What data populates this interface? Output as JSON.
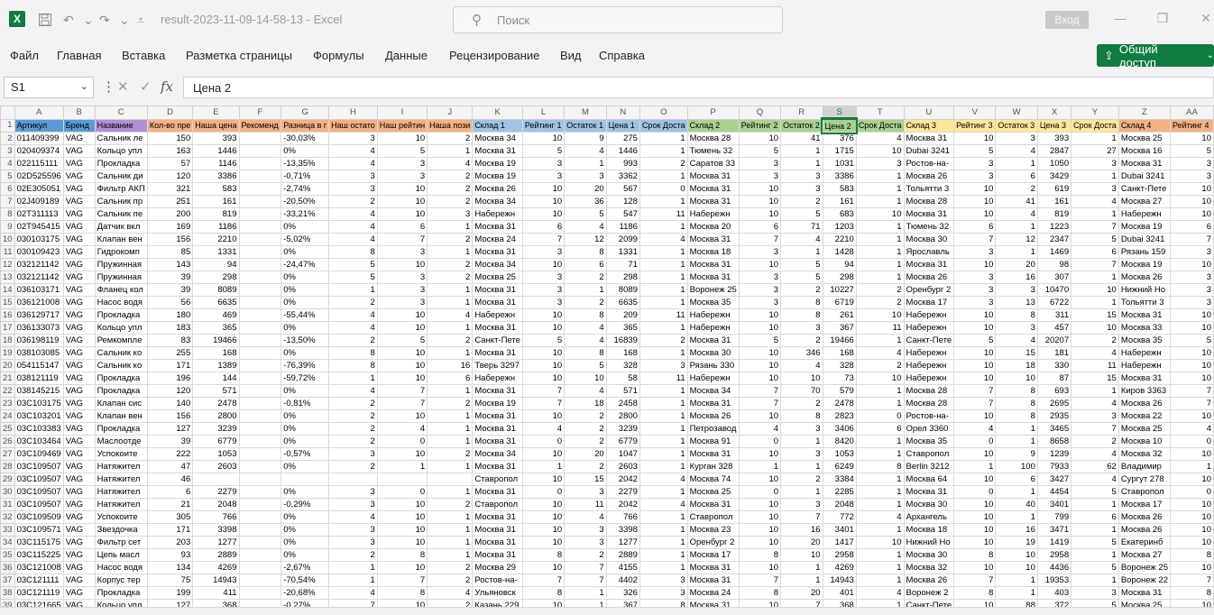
{
  "window": {
    "title": "result-2023-11-09-14-58-13",
    "sep": "-",
    "app": "Excel",
    "search_placeholder": "Поиск",
    "signin_label": "Вход"
  },
  "ribbon_tabs": [
    "Файл",
    "Главная",
    "Вставка",
    "Разметка страницы",
    "Формулы",
    "Данные",
    "Рецензирование",
    "Вид",
    "Справка"
  ],
  "share_label": "Общий доступ",
  "formula_bar": {
    "name_box": "S1",
    "formula": "Цена 2"
  },
  "columns": [
    "A",
    "B",
    "C",
    "D",
    "E",
    "F",
    "G",
    "H",
    "I",
    "J",
    "K",
    "L",
    "M",
    "N",
    "O",
    "P",
    "Q",
    "R",
    "S",
    "T",
    "U",
    "V",
    "W",
    "X",
    "Y",
    "Z",
    "AA"
  ],
  "selected_column": "S",
  "header_row": [
    "Артикул",
    "Бренд",
    "Название",
    "Кол-во пре",
    "Наша цена",
    "Рекоменд",
    "Разница в г",
    "Наш остато",
    "Наш рейтин",
    "Наша пози",
    "Склад 1",
    "Рейтинг 1",
    "Остаток 1",
    "Цена 1",
    "Срок Доста",
    "Склад 2",
    "Рейтинг 2",
    "Остаток 2",
    "Цена 2",
    "Срок Доста",
    "Склад 3",
    "Рейтинг 3",
    "Остаток 3",
    "Цена 3",
    "Срок Доста",
    "Склад 4",
    "Рейтинг 4"
  ],
  "header_colors": [
    "#5b9bd5",
    "#5b9bd5",
    "#b38fd6",
    "#f4b183",
    "#f4b183",
    "#f4b183",
    "#f4b183",
    "#f4b183",
    "#f4b183",
    "#f4b183",
    "#9dc3e6",
    "#9dc3e6",
    "#9dc3e6",
    "#9dc3e6",
    "#9dc3e6",
    "#a9d18e",
    "#a9d18e",
    "#a9d18e",
    "#a9d18e",
    "#a9d18e",
    "#ffe699",
    "#ffe699",
    "#ffe699",
    "#ffe699",
    "#ffe699",
    "#f4b183",
    "#f4b183"
  ],
  "rows": [
    [
      "011409399",
      "VAG",
      "Сальник ле",
      "150",
      "393",
      "",
      "-30,03%",
      "3",
      "10",
      "2",
      "Москва 34",
      "10",
      "9",
      "275",
      "1",
      "Москва 28",
      "10",
      "41",
      "376",
      "4",
      "Москва 31",
      "10",
      "3",
      "393",
      "1",
      "Москва 25",
      "10"
    ],
    [
      "020409374",
      "VAG",
      "Кольцо упл",
      "163",
      "1446",
      "",
      "0%",
      "4",
      "5",
      "1",
      "Москва 31",
      "5",
      "4",
      "1446",
      "1",
      "Тюмень 32",
      "5",
      "1",
      "1715",
      "10",
      "Dubai 3241",
      "5",
      "4",
      "2847",
      "27",
      "Москва 16",
      "5"
    ],
    [
      "022115111",
      "VAG",
      "Прокладка",
      "57",
      "1146",
      "",
      "-13,35%",
      "4",
      "3",
      "4",
      "Москва 19",
      "3",
      "1",
      "993",
      "2",
      "Саратов 33",
      "3",
      "1",
      "1031",
      "3",
      "Ростов-на-",
      "3",
      "1",
      "1050",
      "3",
      "Москва 31",
      "3"
    ],
    [
      "02D525596",
      "VAG",
      "Сальник ди",
      "120",
      "3386",
      "",
      "-0,71%",
      "3",
      "3",
      "2",
      "Москва 19",
      "3",
      "3",
      "3362",
      "1",
      "Москва 31",
      "3",
      "3",
      "3386",
      "1",
      "Москва 26",
      "3",
      "6",
      "3429",
      "1",
      "Dubai 3241",
      "3"
    ],
    [
      "02E305051",
      "VAG",
      "Фильтр АКП",
      "321",
      "583",
      "",
      "-2,74%",
      "3",
      "10",
      "2",
      "Москва 26",
      "10",
      "20",
      "567",
      "0",
      "Москва 31",
      "10",
      "3",
      "583",
      "1",
      "Тольятти 3",
      "10",
      "2",
      "619",
      "3",
      "Санкт-Пете",
      "10"
    ],
    [
      "02J409189",
      "VAG",
      "Сальник пр",
      "251",
      "161",
      "",
      "-20,50%",
      "2",
      "10",
      "2",
      "Москва 34",
      "10",
      "36",
      "128",
      "1",
      "Москва 31",
      "10",
      "2",
      "161",
      "1",
      "Москва 28",
      "10",
      "41",
      "161",
      "4",
      "Москва 27",
      "10"
    ],
    [
      "02T311113",
      "VAG",
      "Сальник пе",
      "200",
      "819",
      "",
      "-33,21%",
      "4",
      "10",
      "3",
      "Набережн",
      "10",
      "5",
      "547",
      "11",
      "Набережн",
      "10",
      "5",
      "683",
      "10",
      "Москва 31",
      "10",
      "4",
      "819",
      "1",
      "Набережн",
      "10"
    ],
    [
      "02T945415",
      "VAG",
      "Датчик вкл",
      "169",
      "1186",
      "",
      "0%",
      "4",
      "6",
      "1",
      "Москва 31",
      "6",
      "4",
      "1186",
      "1",
      "Москва 20",
      "6",
      "71",
      "1203",
      "1",
      "Тюмень 32",
      "6",
      "1",
      "1223",
      "7",
      "Москва 19",
      "6"
    ],
    [
      "030103175",
      "VAG",
      "Клапан вен",
      "156",
      "2210",
      "",
      "-5,02%",
      "4",
      "7",
      "2",
      "Москва 24",
      "7",
      "12",
      "2099",
      "4",
      "Москва 31",
      "7",
      "4",
      "2210",
      "1",
      "Москва 30",
      "7",
      "12",
      "2347",
      "5",
      "Dubai 3241",
      "7"
    ],
    [
      "030109423",
      "VAG",
      "Гидрокомп",
      "85",
      "1331",
      "",
      "0%",
      "8",
      "3",
      "1",
      "Москва 31",
      "3",
      "8",
      "1331",
      "1",
      "Москва 18",
      "3",
      "1",
      "1428",
      "1",
      "Ярославль",
      "3",
      "1",
      "1469",
      "6",
      "Рязань 159",
      "3"
    ],
    [
      "032121142",
      "VAG",
      "Пружинная",
      "143",
      "94",
      "",
      "-24,47%",
      "5",
      "10",
      "2",
      "Москва 34",
      "10",
      "6",
      "71",
      "1",
      "Москва 31",
      "10",
      "5",
      "94",
      "1",
      "Москва 31",
      "10",
      "20",
      "98",
      "7",
      "Москва 19",
      "10"
    ],
    [
      "032121142",
      "VAG",
      "Пружинная",
      "39",
      "298",
      "",
      "0%",
      "5",
      "3",
      "2",
      "Москва 25",
      "3",
      "2",
      "298",
      "1",
      "Москва 31",
      "3",
      "5",
      "298",
      "1",
      "Москва 26",
      "3",
      "16",
      "307",
      "1",
      "Москва 26",
      "3"
    ],
    [
      "036103171",
      "VAG",
      "Фланец кол",
      "39",
      "8089",
      "",
      "0%",
      "1",
      "3",
      "1",
      "Москва 31",
      "3",
      "1",
      "8089",
      "1",
      "Воронеж 25",
      "3",
      "2",
      "10227",
      "2",
      "Оренбург 2",
      "3",
      "3",
      "10470",
      "10",
      "Нижний Но",
      "3"
    ],
    [
      "036121008",
      "VAG",
      "Насос водя",
      "56",
      "6635",
      "",
      "0%",
      "2",
      "3",
      "1",
      "Москва 31",
      "3",
      "2",
      "6635",
      "1",
      "Москва 35",
      "3",
      "8",
      "6719",
      "2",
      "Москва 17",
      "3",
      "13",
      "6722",
      "1",
      "Тольятти 3",
      "3"
    ],
    [
      "036129717",
      "VAG",
      "Прокладка",
      "180",
      "469",
      "",
      "-55,44%",
      "4",
      "10",
      "4",
      "Набережн",
      "10",
      "8",
      "209",
      "11",
      "Набережн",
      "10",
      "8",
      "261",
      "10",
      "Набережн",
      "10",
      "8",
      "311",
      "15",
      "Москва 31",
      "10"
    ],
    [
      "036133073",
      "VAG",
      "Кольцо упл",
      "183",
      "365",
      "",
      "0%",
      "4",
      "10",
      "1",
      "Москва 31",
      "10",
      "4",
      "365",
      "1",
      "Набережн",
      "10",
      "3",
      "367",
      "11",
      "Набережн",
      "10",
      "3",
      "457",
      "10",
      "Москва 33",
      "10"
    ],
    [
      "036198119",
      "VAG",
      "Ремкомпле",
      "83",
      "19466",
      "",
      "-13,50%",
      "2",
      "5",
      "2",
      "Санкт-Пете",
      "5",
      "4",
      "16839",
      "2",
      "Москва 31",
      "5",
      "2",
      "19466",
      "1",
      "Санкт-Пете",
      "5",
      "4",
      "20207",
      "2",
      "Москва 35",
      "5"
    ],
    [
      "038103085",
      "VAG",
      "Сальник ко",
      "255",
      "168",
      "",
      "0%",
      "8",
      "10",
      "1",
      "Москва 31",
      "10",
      "8",
      "168",
      "1",
      "Москва 30",
      "10",
      "346",
      "168",
      "4",
      "Набережн",
      "10",
      "15",
      "181",
      "4",
      "Набережн",
      "10"
    ],
    [
      "054115147",
      "VAG",
      "Сальник ко",
      "171",
      "1389",
      "",
      "-76,39%",
      "8",
      "10",
      "16",
      "Тверь 3297",
      "10",
      "5",
      "328",
      "3",
      "Рязань 330",
      "10",
      "4",
      "328",
      "2",
      "Набережн",
      "10",
      "18",
      "330",
      "11",
      "Набережн",
      "10"
    ],
    [
      "038121119",
      "VAG",
      "Прокладка",
      "196",
      "144",
      "",
      "-59,72%",
      "1",
      "10",
      "6",
      "Набережн",
      "10",
      "10",
      "58",
      "11",
      "Набережн",
      "10",
      "10",
      "73",
      "10",
      "Набережн",
      "10",
      "10",
      "87",
      "15",
      "Москва 31",
      "10"
    ],
    [
      "038145215",
      "VAG",
      "Прокладка",
      "120",
      "571",
      "",
      "0%",
      "4",
      "7",
      "1",
      "Москва 31",
      "7",
      "4",
      "571",
      "1",
      "Москва 34",
      "7",
      "70",
      "579",
      "1",
      "Москва 28",
      "7",
      "8",
      "693",
      "1",
      "Киров 3363",
      "7"
    ],
    [
      "03C103175",
      "VAG",
      "Клапан сис",
      "140",
      "2478",
      "",
      "-0,81%",
      "2",
      "7",
      "2",
      "Москва 19",
      "7",
      "18",
      "2458",
      "1",
      "Москва 31",
      "7",
      "2",
      "2478",
      "1",
      "Москва 28",
      "7",
      "8",
      "2695",
      "4",
      "Москва 26",
      "7"
    ],
    [
      "03C103201",
      "VAG",
      "Клапан вен",
      "156",
      "2800",
      "",
      "0%",
      "2",
      "10",
      "1",
      "Москва 31",
      "10",
      "2",
      "2800",
      "1",
      "Москва 26",
      "10",
      "8",
      "2823",
      "0",
      "Ростов-на-",
      "10",
      "8",
      "2935",
      "3",
      "Москва 22",
      "10"
    ],
    [
      "03C103383",
      "VAG",
      "Прокладка",
      "127",
      "3239",
      "",
      "0%",
      "2",
      "4",
      "1",
      "Москва 31",
      "4",
      "2",
      "3239",
      "1",
      "Петрозавод",
      "4",
      "3",
      "3406",
      "6",
      "Орел 3360",
      "4",
      "1",
      "3465",
      "7",
      "Москва 25",
      "4"
    ],
    [
      "03C103464",
      "VAG",
      "Маслоотде",
      "39",
      "6779",
      "",
      "0%",
      "2",
      "0",
      "1",
      "Москва 31",
      "0",
      "2",
      "6779",
      "1",
      "Москва 91",
      "0",
      "1",
      "8420",
      "1",
      "Москва 35",
      "0",
      "1",
      "8658",
      "2",
      "Москва 10",
      "0"
    ],
    [
      "03C109469",
      "VAG",
      "Успокоите",
      "222",
      "1053",
      "",
      "-0,57%",
      "3",
      "10",
      "2",
      "Москва 34",
      "10",
      "20",
      "1047",
      "1",
      "Москва 31",
      "10",
      "3",
      "1053",
      "1",
      "Ставропол",
      "10",
      "9",
      "1239",
      "4",
      "Москва 32",
      "10"
    ],
    [
      "03C109507",
      "VAG",
      "Натяжител",
      "47",
      "2603",
      "",
      "0%",
      "2",
      "1",
      "1",
      "Москва 31",
      "1",
      "2",
      "2603",
      "1",
      "Курган 328",
      "1",
      "1",
      "6249",
      "8",
      "Berlin 3212",
      "1",
      "100",
      "7933",
      "62",
      "Владимир",
      "1"
    ],
    [
      "03C109507",
      "VAG",
      "Натяжител",
      "46",
      "",
      "",
      "",
      "",
      "",
      "",
      "Ставропол",
      "10",
      "15",
      "2042",
      "4",
      "Москва 74",
      "10",
      "2",
      "3384",
      "1",
      "Москва 64",
      "10",
      "6",
      "3427",
      "4",
      "Сургут 278",
      "10"
    ],
    [
      "03C109507",
      "VAG",
      "Натяжител",
      "6",
      "2279",
      "",
      "0%",
      "3",
      "0",
      "1",
      "Москва 31",
      "0",
      "3",
      "2279",
      "1",
      "Москва 25",
      "0",
      "1",
      "2285",
      "1",
      "Москва 31",
      "0",
      "1",
      "4454",
      "5",
      "Ставропол",
      "0"
    ],
    [
      "03C109507",
      "VAG",
      "Натяжител",
      "21",
      "2048",
      "",
      "-0,29%",
      "3",
      "10",
      "2",
      "Ставропол",
      "10",
      "11",
      "2042",
      "4",
      "Москва 31",
      "10",
      "3",
      "2048",
      "1",
      "Москва 30",
      "10",
      "40",
      "3401",
      "1",
      "Москва 17",
      "10"
    ],
    [
      "03C109509",
      "VAG",
      "Успокоите",
      "305",
      "766",
      "",
      "0%",
      "4",
      "10",
      "1",
      "Москва 31",
      "10",
      "4",
      "766",
      "1",
      "Ставропол",
      "10",
      "7",
      "772",
      "4",
      "Архангель",
      "10",
      "1",
      "799",
      "6",
      "Москва 26",
      "10"
    ],
    [
      "03C109571",
      "VAG",
      "Звездочка",
      "171",
      "3398",
      "",
      "0%",
      "3",
      "10",
      "1",
      "Москва 31",
      "10",
      "3",
      "3398",
      "1",
      "Москва 23",
      "10",
      "16",
      "3401",
      "1",
      "Москва 18",
      "10",
      "16",
      "3471",
      "1",
      "Москва 26",
      "10"
    ],
    [
      "03C115175",
      "VAG",
      "Фильтр сет",
      "203",
      "1277",
      "",
      "0%",
      "3",
      "10",
      "1",
      "Москва 31",
      "10",
      "3",
      "1277",
      "1",
      "Оренбург 2",
      "10",
      "20",
      "1417",
      "10",
      "Нижний Но",
      "10",
      "19",
      "1419",
      "5",
      "Екатеринб",
      "10"
    ],
    [
      "03C115225",
      "VAG",
      "Цепь масл",
      "93",
      "2889",
      "",
      "0%",
      "2",
      "8",
      "1",
      "Москва 31",
      "8",
      "2",
      "2889",
      "1",
      "Москва 17",
      "8",
      "10",
      "2958",
      "1",
      "Москва 30",
      "8",
      "10",
      "2958",
      "1",
      "Москва 27",
      "8"
    ],
    [
      "03C121008",
      "VAG",
      "Насос водя",
      "134",
      "4269",
      "",
      "-2,67%",
      "1",
      "10",
      "2",
      "Москва 29",
      "10",
      "7",
      "4155",
      "1",
      "Москва 31",
      "10",
      "1",
      "4269",
      "1",
      "Москва 32",
      "10",
      "10",
      "4436",
      "5",
      "Воронеж 25",
      "10"
    ],
    [
      "03C121111",
      "VAG",
      "Корпус тер",
      "75",
      "14943",
      "",
      "-70,54%",
      "1",
      "7",
      "2",
      "Ростов-на-",
      "7",
      "7",
      "4402",
      "3",
      "Москва 31",
      "7",
      "1",
      "14943",
      "1",
      "Москва 26",
      "7",
      "1",
      "19353",
      "1",
      "Воронеж 22",
      "7"
    ],
    [
      "03C121119",
      "VAG",
      "Прокладка",
      "199",
      "411",
      "",
      "-20,68%",
      "4",
      "8",
      "4",
      "Ульяновск",
      "8",
      "1",
      "326",
      "3",
      "Москва 24",
      "8",
      "20",
      "401",
      "4",
      "Воронеж 2",
      "8",
      "1",
      "403",
      "3",
      "Москва 31",
      "8"
    ],
    [
      "03C121665",
      "VAG",
      "Кольцо упл",
      "127",
      "368",
      "",
      "-0,27%",
      "7",
      "10",
      "2",
      "Казань 229",
      "10",
      "1",
      "367",
      "8",
      "Москва 31",
      "10",
      "7",
      "368",
      "1",
      "Санкт-Пете",
      "10",
      "88",
      "372",
      "5",
      "Москва 25",
      "10"
    ]
  ]
}
